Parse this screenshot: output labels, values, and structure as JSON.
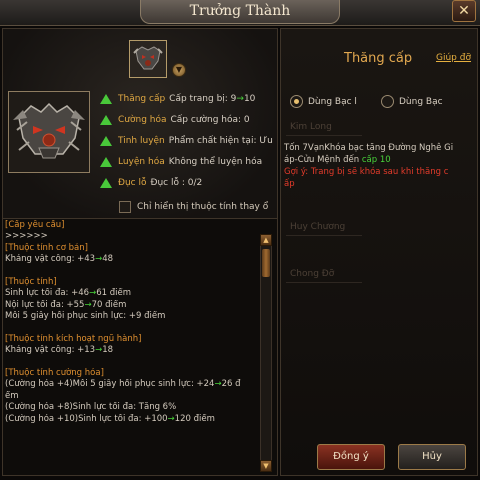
{
  "window": {
    "title": "Trưởng Thành"
  },
  "attributes": [
    {
      "key": "Thăng cấp",
      "value": "Cấp trang bị: 9",
      "arrow": "→",
      "new": "10"
    },
    {
      "key": "Cường hóa",
      "value": "Cấp cường hóa: 0"
    },
    {
      "key": "Tinh luyện",
      "value": "Phẩm chất hiện tại: Ưu"
    },
    {
      "key": "Luyện hóa",
      "value": "Không thể luyện hóa"
    },
    {
      "key": "Đục lỗ",
      "value": "Đục lỗ : 0/2"
    }
  ],
  "checkbox": {
    "label": "Chỉ hiển thị thuộc tính thay ổ"
  },
  "details": [
    {
      "kind": "sec",
      "text": "[Cấp yêu cầu]"
    },
    {
      "kind": "plain",
      "text": ">>>>>>"
    },
    {
      "kind": "sec",
      "text": "[Thuộc tính cơ bản]"
    },
    {
      "kind": "plain",
      "text": "Kháng vật công: +43",
      "arrow": "→",
      "new": "48"
    },
    {
      "kind": "blank",
      "text": ""
    },
    {
      "kind": "sec",
      "text": "[Thuộc tính]"
    },
    {
      "kind": "plain",
      "text": "Sinh lực tối đa: +46",
      "arrow": "→",
      "new": "61 điểm"
    },
    {
      "kind": "plain",
      "text": "Nội lực tối đa: +55",
      "arrow": "→",
      "new": "70 điểm"
    },
    {
      "kind": "plain",
      "text": "Mỗi 5 giây hồi phục sinh lực: +9 điểm"
    },
    {
      "kind": "blank",
      "text": ""
    },
    {
      "kind": "sec",
      "text": "[Thuộc tính kích hoạt ngũ hành]"
    },
    {
      "kind": "plain",
      "text": "Kháng vật công: +13",
      "arrow": "→",
      "new": "18"
    },
    {
      "kind": "blank",
      "text": ""
    },
    {
      "kind": "sec",
      "text": "[Thuộc tính cường hóa]"
    },
    {
      "kind": "plain",
      "text": "(Cường hóa +4)Mỗi 5 giây hồi phục sinh lực: +24",
      "arrow": "→",
      "new": "26 đ"
    },
    {
      "kind": "plain",
      "text": "ểm"
    },
    {
      "kind": "plain",
      "text": "(Cường hóa +8)Sinh lực tối đa: Tăng 6%"
    },
    {
      "kind": "plain",
      "text": "(Cường hóa +10)Sinh lực tối đa: +100",
      "arrow": "→",
      "new": "120 điểm"
    }
  ],
  "right": {
    "title": "Thăng cấp",
    "help": "Giúp đỡ",
    "radio1": "Dùng Bạc l",
    "radio2": "Dùng Bạc",
    "ghost1": "Kim Long",
    "ghost2": "Huy Chương",
    "ghost3": "Chong Đỡ",
    "info1": "Tốn 7VạnKhóa bạc tăng Đường Nghê Gi",
    "info2_a": "áp-Cửu Mệnh đến ",
    "info2_b": "cấp 10",
    "warn1": "Gợi ý: Trang bị sẽ khóa sau khi thăng c",
    "warn2": "ấp"
  },
  "buttons": {
    "ok": "Đồng ý",
    "cancel": "Hủy"
  }
}
